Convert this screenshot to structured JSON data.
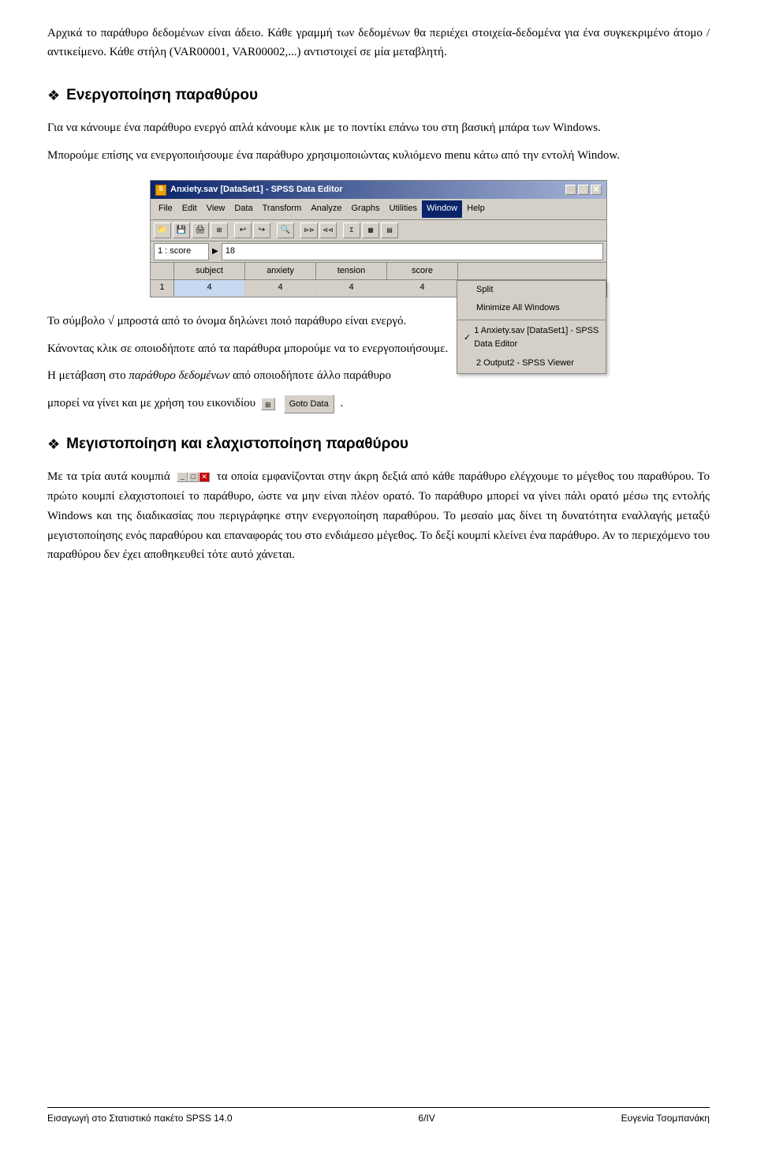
{
  "page": {
    "paragraphs": {
      "intro1": "Αρχικά το παράθυρο δεδομένων είναι άδειο. Κάθε γραμμή των δεδομένων θα περιέχει στοιχεία-δεδομένα για ένα συγκεκριμένο άτομο / αντικείμενο. Κάθε στήλη (VAR00001, VAR00002,...) αντιστοιχεί σε μία μεταβλητή."
    },
    "section1": {
      "icon": "❖",
      "title": "Ενεργοποίηση παραθύρου",
      "body1": "Για να κάνουμε ένα παράθυρο ενεργό απλά κάνουμε κλικ με το ποντίκι επάνω του στη βασική μπάρα των Windows.",
      "body2": "Μπορούμε επίσης να ενεργοποιήσουμε ένα παράθυρο χρησιμοποιώντας κυλιόμενο menu κάτω από την εντολή Window."
    },
    "spss": {
      "titlebar": "Anxiety.sav [DataSet1] - SPSS Data Editor",
      "menus": [
        "File",
        "Edit",
        "View",
        "Data",
        "Transform",
        "Analyze",
        "Graphs",
        "Utilities",
        "Window",
        "Help"
      ],
      "active_menu": "Window",
      "cell_ref": "1 : score",
      "cell_value": "18",
      "columns": [
        "subject",
        "anxiety",
        "tension",
        "score"
      ],
      "row_data": [
        [
          "",
          "",
          "",
          ""
        ],
        [
          "",
          "",
          "",
          ""
        ]
      ],
      "window_menu": {
        "items": [
          {
            "label": "Split",
            "check": ""
          },
          {
            "label": "Minimize All Windows",
            "check": ""
          },
          {
            "label": "---"
          },
          {
            "label": "1 Anxiety.sav [DataSet1] - SPSS Data Editor",
            "check": "✓"
          },
          {
            "label": "2 Output2 - SPSS Viewer",
            "check": ""
          }
        ]
      }
    },
    "after_screenshot": {
      "line1": "Το σύμβολο √ μπροστά από το όνομα δηλώνει ποιό παράθυρο είναι ενεργό.",
      "line2": "Κάνοντας κλικ σε οποιοδήποτε από τα παράθυρα μπορούμε να το ενεργοποιήσουμε.",
      "line3_start": "Η μετάβαση στο ",
      "line3_italic": "παράθυρο δεδομένων",
      "line3_end": " από οποιοδήποτε άλλο παράθυρο",
      "line4": "μπορεί να γίνει και με χρήση του εικονιδίου",
      "line4_end": ".",
      "goto_label": "Goto Data"
    },
    "section2": {
      "icon": "❖",
      "title": "Μεγιστοποίηση και ελαχιστοποίηση παραθύρου",
      "body": "Με τα τρία αυτά κουμπιά     τα  οποία εμφανίζονται στην άκρη δεξιά από κάθε παράθυρο ελέγχουμε το μέγεθος του παραθύρου. Το πρώτο κουμπί ελαχιστοποιεί το παράθυρο, ώστε να μην είναι πλέον ορατό. Το παράθυρο μπορεί να γίνει πάλι ορατό μέσω της εντολής Windows και της  διαδικασίας που περιγράφηκε στην ενεργοποίηση παραθύρου. Το μεσαίο μας δίνει τη δυνατότητα εναλλαγής μεταξύ μεγιστοποίησης ενός παραθύρου και επαναφοράς του στο ενδιάμεσο μέγεθος. Το δεξί κουμπί κλείνει ένα παράθυρο. Αν το περιεχόμενο του παραθύρου δεν έχει αποθηκευθεί τότε αυτό χάνεται."
    },
    "footer": {
      "left": "Εισαγωγή στο Στατιστικό πακέτο SPSS 14.0",
      "center": "6/IV",
      "right": "Ευγενία Τσομπανάκη"
    }
  }
}
